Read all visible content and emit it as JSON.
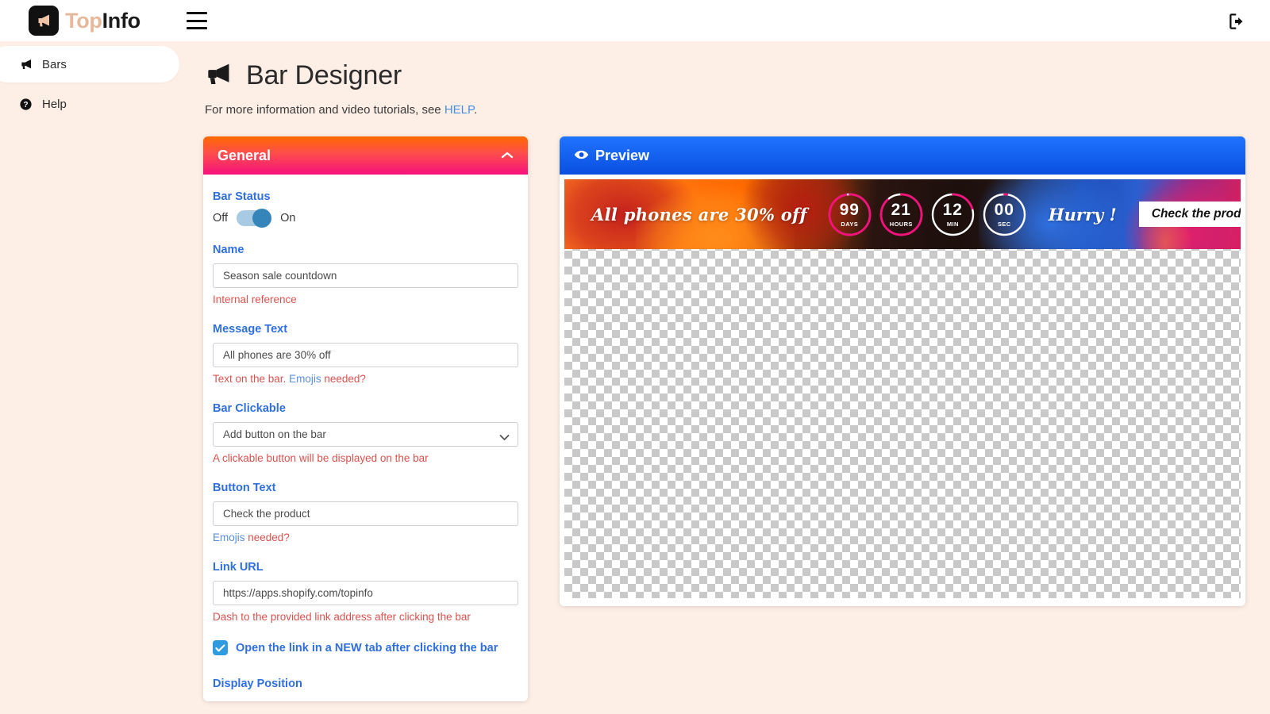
{
  "app": {
    "brand_top": "Top",
    "brand_info": "Info",
    "brand_icon": "megaphone-icon",
    "menu_icon": "hamburger-icon",
    "logout_icon": "logout-icon"
  },
  "sidebar": {
    "items": [
      {
        "label": "Bars",
        "icon": "megaphone-icon",
        "active": true
      },
      {
        "label": "Help",
        "icon": "question-circle-icon",
        "active": false
      }
    ]
  },
  "page": {
    "title": "Bar Designer",
    "title_icon": "megaphone-icon",
    "subtitle_before": "For more information and video tutorials, see ",
    "subtitle_link": "HELP",
    "subtitle_after": "."
  },
  "general_panel": {
    "header": "General",
    "collapse_icon": "chevron-up-icon",
    "bar_status": {
      "label": "Bar Status",
      "off_label": "Off",
      "on_label": "On",
      "value": "On"
    },
    "name": {
      "label": "Name",
      "value": "Season sale countdown",
      "placeholder": "Season sale countdown",
      "hint": "Internal reference"
    },
    "message_text": {
      "label": "Message Text",
      "value": "All phones are 30% off",
      "placeholder": "All phones are 30% off",
      "hint_before": "Text on the bar. ",
      "hint_link": "Emojis",
      "hint_after": " needed?"
    },
    "bar_clickable": {
      "label": "Bar Clickable",
      "value": "Add button on the bar",
      "options": [
        "Add button on the bar"
      ],
      "hint": "A clickable button will be displayed on the bar",
      "arrow_icon": "chevron-down-icon"
    },
    "button_text": {
      "label": "Button Text",
      "value": "Check the product",
      "placeholder": "Check the product",
      "hint_link": "Emojis",
      "hint_after": " needed?"
    },
    "link_url": {
      "label": "Link URL",
      "value": "https://apps.shopify.com/topinfo",
      "placeholder": "https://apps.shopify.com/topinfo",
      "hint": "Dash to the provided link address after clicking the bar"
    },
    "new_tab": {
      "label": "Open the link in a NEW tab after clicking the bar",
      "checked": true,
      "check_icon": "checkmark-icon"
    },
    "display_position": {
      "label": "Display Position"
    }
  },
  "preview_panel": {
    "header": "Preview",
    "header_icon": "eye-icon",
    "bar": {
      "message": "All phones are 30% off",
      "hurry_text": "Hurry !",
      "button_label": "Check the product",
      "counters": [
        {
          "value": "99",
          "unit": "DAYS",
          "progress": 0.97
        },
        {
          "value": "21",
          "unit": "HOURS",
          "progress": 0.88
        },
        {
          "value": "12",
          "unit": "MIN",
          "progress": 0.2
        },
        {
          "value": "00",
          "unit": "SEC",
          "progress": 0.02
        }
      ],
      "ring_color": "#f5107c",
      "ring_track_color": "#ffffff"
    }
  },
  "colors": {
    "page_background": "#fdeee6",
    "accent_blue": "#2f6fe0",
    "hint_red": "#d9534f",
    "panel_gradient_start": "#ff6a00",
    "panel_gradient_end": "#f5107c",
    "preview_gradient_start": "#1f74ff",
    "preview_gradient_end": "#0b4fe0"
  }
}
